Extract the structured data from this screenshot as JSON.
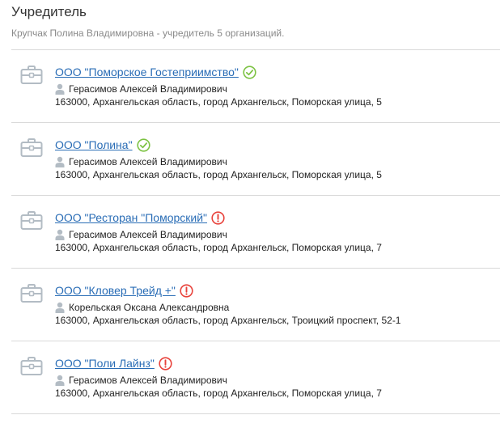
{
  "section": {
    "title": "Учредитель",
    "subtitle": "Крупчак Полина Владимировна - учредитель 5 организаций."
  },
  "colors": {
    "link": "#2a6db6",
    "status_ok": "#7cc242",
    "status_warning": "#e8413a",
    "icon_gray": "#b3bcc4"
  },
  "organizations": [
    {
      "name": "ООО \"Поморское Гостеприимство\"",
      "status": "ok",
      "status_icon": "check-circle-icon",
      "person": "Герасимов Алексей Владимирович",
      "address": "163000, Архангельская область, город Архангельск, Поморская улица, 5"
    },
    {
      "name": "ООО \"Полина\"",
      "status": "ok",
      "status_icon": "check-circle-icon",
      "person": "Герасимов Алексей Владимирович",
      "address": "163000, Архангельская область, город Архангельск, Поморская улица, 5"
    },
    {
      "name": "ООО \"Ресторан \"Поморский\"",
      "status": "warning",
      "status_icon": "exclamation-circle-icon",
      "person": "Герасимов Алексей Владимирович",
      "address": "163000, Архангельская область, город Архангельск, Поморская улица, 7"
    },
    {
      "name": "ООО \"Кловер Трейд +\"",
      "status": "warning",
      "status_icon": "exclamation-circle-icon",
      "person": "Корельская Оксана Александровна",
      "address": "163000, Архангельская область, город Архангельск, Троицкий проспект, 52-1"
    },
    {
      "name": "ООО \"Поли Лайнз\"",
      "status": "warning",
      "status_icon": "exclamation-circle-icon",
      "person": "Герасимов Алексей Владимирович",
      "address": "163000, Архангельская область, город Архангельск, Поморская улица, 7"
    }
  ]
}
